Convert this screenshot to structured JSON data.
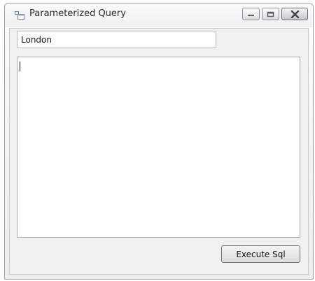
{
  "window": {
    "title": "Parameterized Query",
    "icon": "form-window-icon",
    "controls": {
      "minimize": "minimize-icon",
      "maximize": "maximize-icon",
      "close": "close-icon"
    }
  },
  "form": {
    "parameter_value": "London",
    "sql_text": "",
    "execute_label": "Execute Sql"
  }
}
